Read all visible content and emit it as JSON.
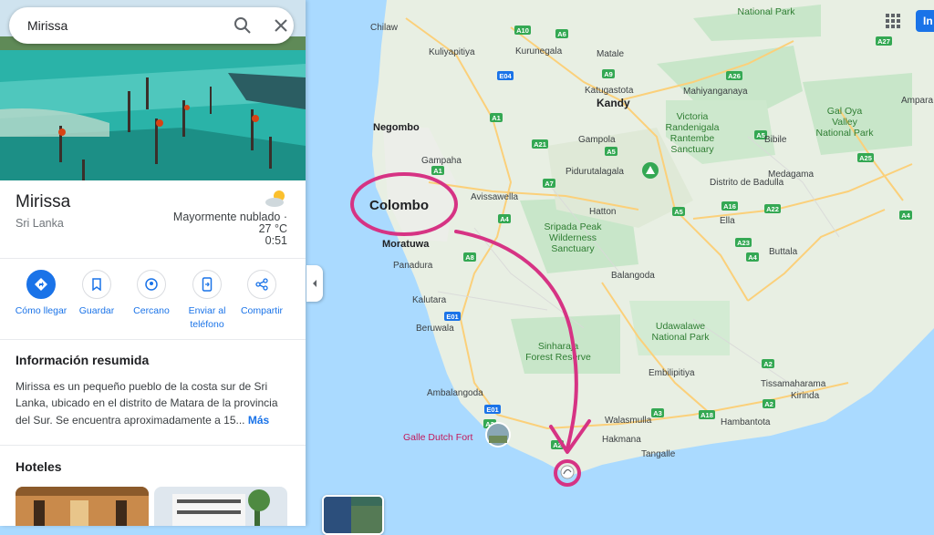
{
  "search": {
    "value": "Mirissa"
  },
  "place": {
    "name": "Mirissa",
    "country": "Sri Lanka",
    "weather": {
      "condition": "Mayormente nublado ·",
      "temp": "27 °C",
      "time": "0:51",
      "icon": "partly-cloudy-icon"
    }
  },
  "actions": [
    {
      "label": "Cómo llegar",
      "icon": "directions-icon"
    },
    {
      "label": "Guardar",
      "icon": "bookmark-icon"
    },
    {
      "label": "Cercano",
      "icon": "nearby-icon"
    },
    {
      "label": "Enviar al teléfono",
      "icon": "send-to-phone-icon"
    },
    {
      "label": "Compartir",
      "icon": "share-icon"
    }
  ],
  "summary": {
    "title": "Información resumida",
    "text": "Mirissa es un pequeño pueblo de la costa sur de Sri Lanka, ubicado en el distrito de Matara de la provincia del Sur. Se encuentra aproximadamente a 15...",
    "more": "Más"
  },
  "hotels": {
    "title": "Hoteles"
  },
  "header": {
    "signin": "In"
  },
  "colors": {
    "water": "#aadaff",
    "land": "#e8efe3",
    "park": "#c8e6c9",
    "road": "#fbd07a",
    "annotation": "#d63384",
    "accent": "#1a73e8"
  },
  "map": {
    "cities": [
      "Chilaw",
      "Kuliyapitiya",
      "Kurunegala",
      "Matale",
      "Katugastota",
      "Kandy",
      "Mahiyanganaya",
      "Negombo",
      "Gampaha",
      "Gampola",
      "Avissawella",
      "Colombo",
      "Moratuwa",
      "Panadura",
      "Kalutara",
      "Beruwala",
      "Ambalangoda",
      "Hatton",
      "Balangoda",
      "Bibile",
      "Medagama",
      "Distrito de Badulla",
      "Ella",
      "Buttala",
      "Embilipitiya",
      "Walasmulla",
      "Hakmana",
      "Tangalle",
      "Hambantota",
      "Tissamaharama",
      "Kirinda",
      "Pidurutalagala",
      "Ampara"
    ],
    "parks": [
      "National Park",
      "Victoria Randenigala Rantembe Sanctuary",
      "Gal Oya Valley National Park",
      "Sripada Peak Wilderness Sanctuary",
      "Sinharaja Forest Reserve",
      "Udawalawe National Park"
    ],
    "highways": [
      "A10",
      "A6",
      "E04",
      "A9",
      "A1",
      "A21",
      "A5",
      "A7",
      "A4",
      "A26",
      "A27",
      "A5",
      "A25",
      "A16",
      "A22",
      "A23",
      "A8",
      "E01",
      "A2",
      "A18",
      "A3",
      "A6"
    ],
    "poi": "Galle Dutch Fort"
  }
}
